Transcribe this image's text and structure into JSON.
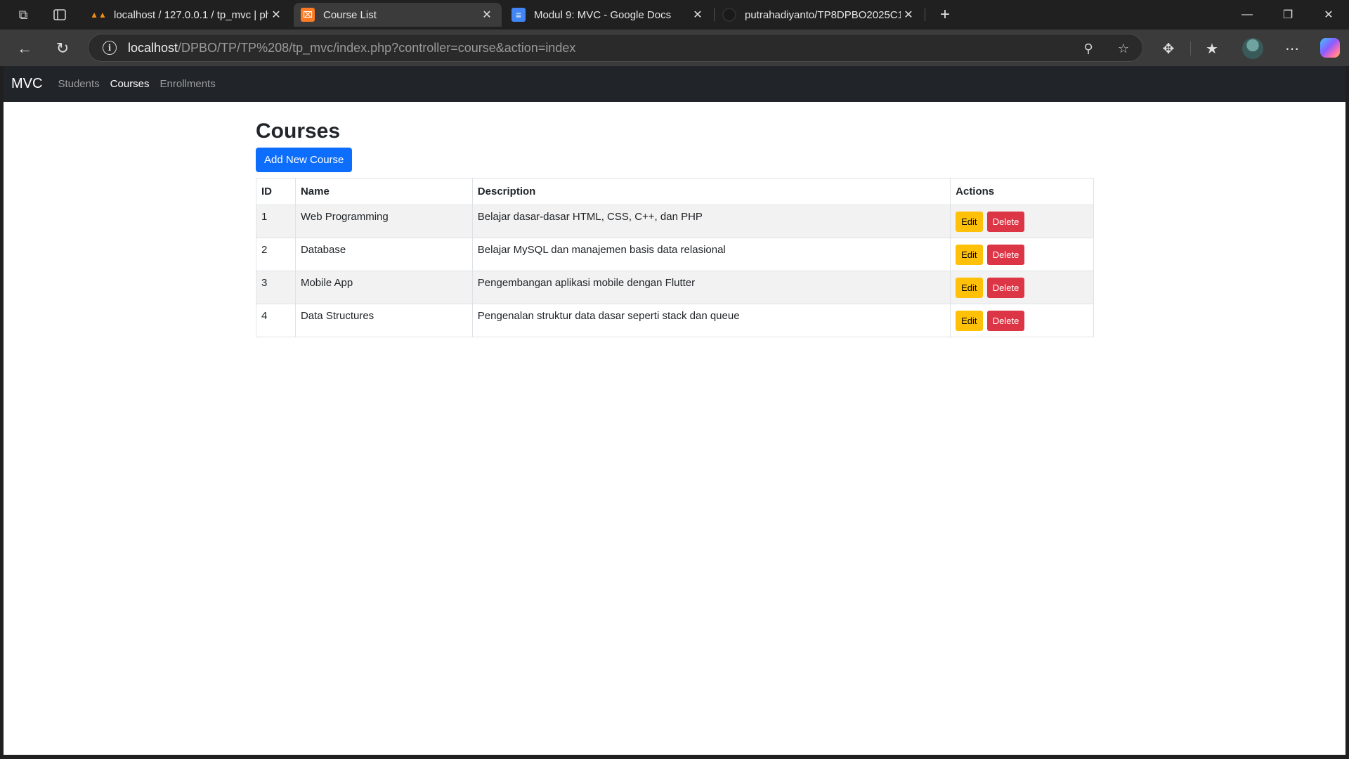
{
  "browser": {
    "tabs": [
      {
        "title": "localhost / 127.0.0.1 / tp_mvc | ph",
        "favicon": "phpmyadmin-icon"
      },
      {
        "title": "Course List",
        "favicon": "xampp-icon"
      },
      {
        "title": "Modul 9: MVC - Google Docs",
        "favicon": "google-docs-icon"
      },
      {
        "title": "putrahadiyanto/TP8DPBO2025C1",
        "favicon": "github-icon"
      }
    ],
    "address": {
      "host": "localhost",
      "path": "/DPBO/TP/TP%208/tp_mvc/index.php?controller=course&action=index"
    }
  },
  "navbar": {
    "brand": "MVC",
    "links": [
      "Students",
      "Courses",
      "Enrollments"
    ],
    "active": "Courses"
  },
  "page": {
    "title": "Courses",
    "add_button": "Add New Course"
  },
  "table": {
    "headers": [
      "ID",
      "Name",
      "Description",
      "Actions"
    ],
    "rows": [
      {
        "id": "1",
        "name": "Web Programming",
        "description": "Belajar dasar-dasar HTML, CSS, C++, dan PHP"
      },
      {
        "id": "2",
        "name": "Database",
        "description": "Belajar MySQL dan manajemen basis data relasional"
      },
      {
        "id": "3",
        "name": "Mobile App",
        "description": "Pengembangan aplikasi mobile dengan Flutter"
      },
      {
        "id": "4",
        "name": "Data Structures",
        "description": "Pengenalan struktur data dasar seperti stack dan queue"
      }
    ],
    "edit_label": "Edit",
    "delete_label": "Delete"
  },
  "colors": {
    "primary": "#0d6efd",
    "warning": "#ffc107",
    "danger": "#dc3545",
    "navbar": "#212529"
  }
}
